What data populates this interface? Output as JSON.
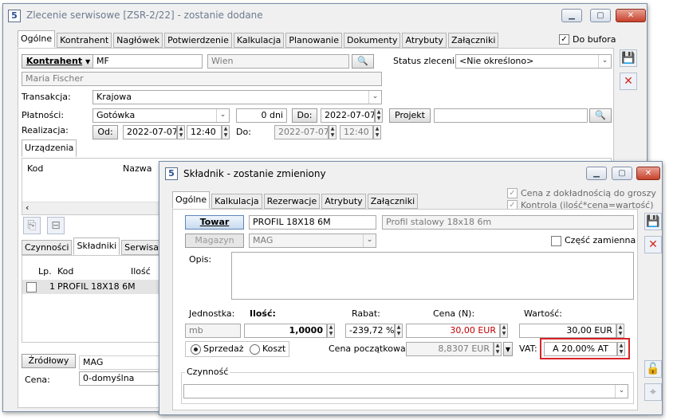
{
  "main_window": {
    "title": "Zlecenie serwisowe [ZSR-2/22]  - zostanie dodane",
    "app_icon": "5",
    "tabs": [
      "Ogólne",
      "Kontrahent",
      "Nagłówek",
      "Potwierdzenie",
      "Kalkulacja",
      "Planowanie",
      "Dokumenty",
      "Atrybuty",
      "Załączniki"
    ],
    "active_tab": "Ogólne",
    "do_bufora": {
      "label": "Do bufora",
      "checked": true
    },
    "kontrahent": {
      "button": "Kontrahent",
      "code": "MF",
      "city": "Wien",
      "name": "Maria Fischer"
    },
    "status": {
      "label": "Status zlecenia:",
      "value": "<Nie określono>"
    },
    "transakcja": {
      "label": "Transakcja:",
      "value": "Krajowa"
    },
    "platnosci": {
      "label": "Płatności:",
      "value": "Gotówka",
      "days": "0 dni",
      "do_button": "Do:",
      "do_date": "2022-07-07"
    },
    "projekt": {
      "button": "Projekt",
      "value": ""
    },
    "realizacja": {
      "label": "Realizacja:",
      "od_button": "Od:",
      "od_date": "2022-07-07",
      "od_time": "12:40",
      "do_label": "Do:",
      "do_date": "2022-07-07",
      "do_time": "12:40"
    },
    "urzadzenia_tab": "Urządzenia",
    "device_grid": {
      "columns": [
        "Kod",
        "Nazwa"
      ]
    },
    "bottom_tabs": [
      "Czynności",
      "Składniki",
      "Serwisanci"
    ],
    "active_bottom_tab": "Składniki",
    "component_grid": {
      "columns": [
        "Lp.",
        "Kod",
        "Ilość"
      ],
      "rows": [
        {
          "lp": "1",
          "kod": "PROFIL 18X18 6M"
        }
      ]
    },
    "zrodlowy": {
      "button": "Źródłowy",
      "value": "MAG"
    },
    "cena": {
      "label": "Cena:",
      "value": "0-domyślna"
    }
  },
  "dialog": {
    "title": "Składnik - zostanie zmieniony",
    "app_icon": "5",
    "tabs": [
      "Ogólne",
      "Kalkulacja",
      "Rezerwacje",
      "Atrybuty",
      "Załączniki"
    ],
    "active_tab": "Ogólne",
    "cena_dokladnosc": {
      "label": "Cena z dokładnością do groszy",
      "checked": true
    },
    "kontrola": {
      "label": "Kontrola (ilość*cena=wartość)",
      "checked": true
    },
    "towar": {
      "button": "Towar",
      "code": "PROFIL 18X18 6M",
      "name": "Profil stalowy 18x18 6m"
    },
    "magazyn": {
      "button": "Magazyn",
      "value": "MAG"
    },
    "czesc_zamienna": {
      "label": "Część zamienna",
      "checked": false
    },
    "opis": {
      "label": "Opis:",
      "value": ""
    },
    "jednostka": {
      "label": "Jednostka:",
      "value": "mb"
    },
    "ilosc": {
      "label": "Ilość:",
      "value": "1,0000"
    },
    "rabat": {
      "label": "Rabat:",
      "value": "-239,72 %"
    },
    "cena_n": {
      "label": "Cena (N):",
      "value": "30,00 EUR"
    },
    "wartosc": {
      "label": "Wartość:",
      "value": "30,00 EUR"
    },
    "sprzedaz": {
      "label": "Sprzedaż",
      "selected": true
    },
    "koszt": {
      "label": "Koszt",
      "selected": false
    },
    "cena_poczatkowa": {
      "label": "Cena początkowa:",
      "value": "8,8307 EUR"
    },
    "vat": {
      "label": "VAT:",
      "value": "A 20,00% AT"
    },
    "czynnosc": {
      "label": "Czynność",
      "value": ""
    }
  },
  "colors": {
    "highlight_border": "#d8232a",
    "price_text": "#c00000",
    "save_icon": "#2a5ea8",
    "cancel_icon": "#d0281c"
  }
}
